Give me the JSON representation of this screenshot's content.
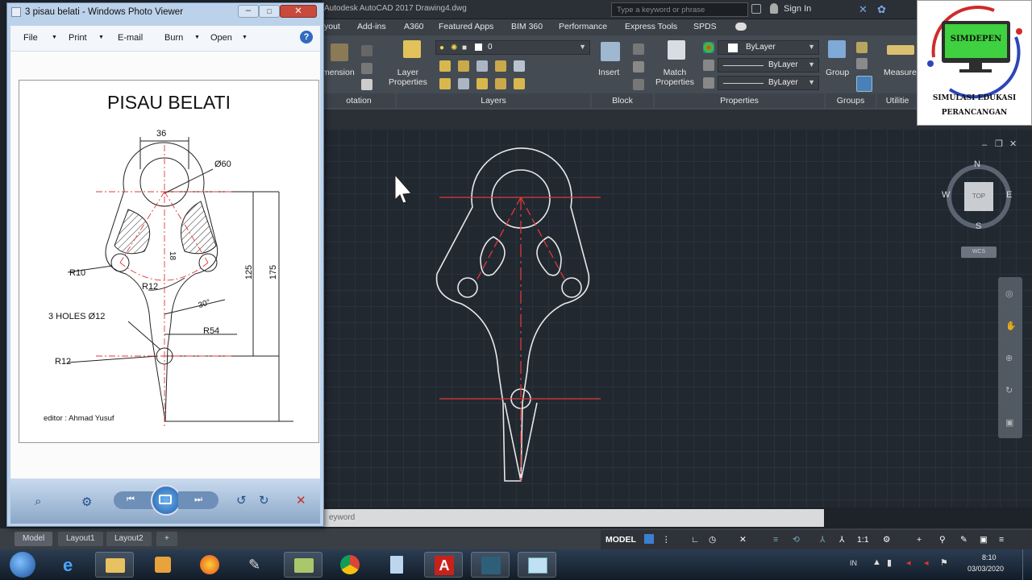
{
  "autocad": {
    "title": "Autodesk AutoCAD 2017    Drawing4.dwg",
    "search_placeholder": "Type a keyword or phrase",
    "sign_in": "Sign In",
    "ribbon_tabs": [
      "yout",
      "Add-ins",
      "A360",
      "Featured Apps",
      "BIM 360",
      "Performance",
      "Express Tools",
      "SPDS"
    ],
    "panels": {
      "dimension": "mension",
      "layer_properties": "Layer\nProperties",
      "layer_current": "0",
      "insert": "Insert",
      "match_properties": "Match\nProperties",
      "bylayer_color": "ByLayer",
      "bylayer_linetype": "ByLayer",
      "bylayer_lineweight": "ByLayer",
      "group": "Group",
      "measure": "Measure"
    },
    "panel_titles": [
      "otation",
      "Layers",
      "Block",
      "Properties",
      "Groups",
      "Utilitie"
    ],
    "viewcube": {
      "n": "N",
      "s": "S",
      "e": "E",
      "w": "W",
      "top": "TOP",
      "wcs": "WCS"
    },
    "command_placeholder": "eyword",
    "layout_tabs": [
      "Model",
      "Layout1",
      "Layout2",
      "+"
    ],
    "status": {
      "model": "MODEL",
      "scale": "1:1"
    }
  },
  "photo_viewer": {
    "title": "3 pisau belati - Windows Photo Viewer",
    "menu": [
      "File",
      "Print",
      "E-mail",
      "Burn",
      "Open"
    ],
    "drawing": {
      "title": "PISAU BELATI",
      "dims": {
        "d36": "36",
        "d60": "Ø60",
        "r10": "R10",
        "r12a": "R12",
        "d18": "18",
        "d125": "125",
        "d175": "175",
        "a30": "30°",
        "holes": "3 HOLES Ø12",
        "r54": "R54",
        "r12b": "R12"
      },
      "editor": "editor : Ahmad Yusuf"
    }
  },
  "logo": {
    "name": "SIMDEPEN",
    "line1": "SIMULASI EDUKASI",
    "line2": "PERANCANGAN"
  },
  "taskbar": {
    "lang": "IN",
    "time": "8:10",
    "date": "03/03/2020"
  }
}
